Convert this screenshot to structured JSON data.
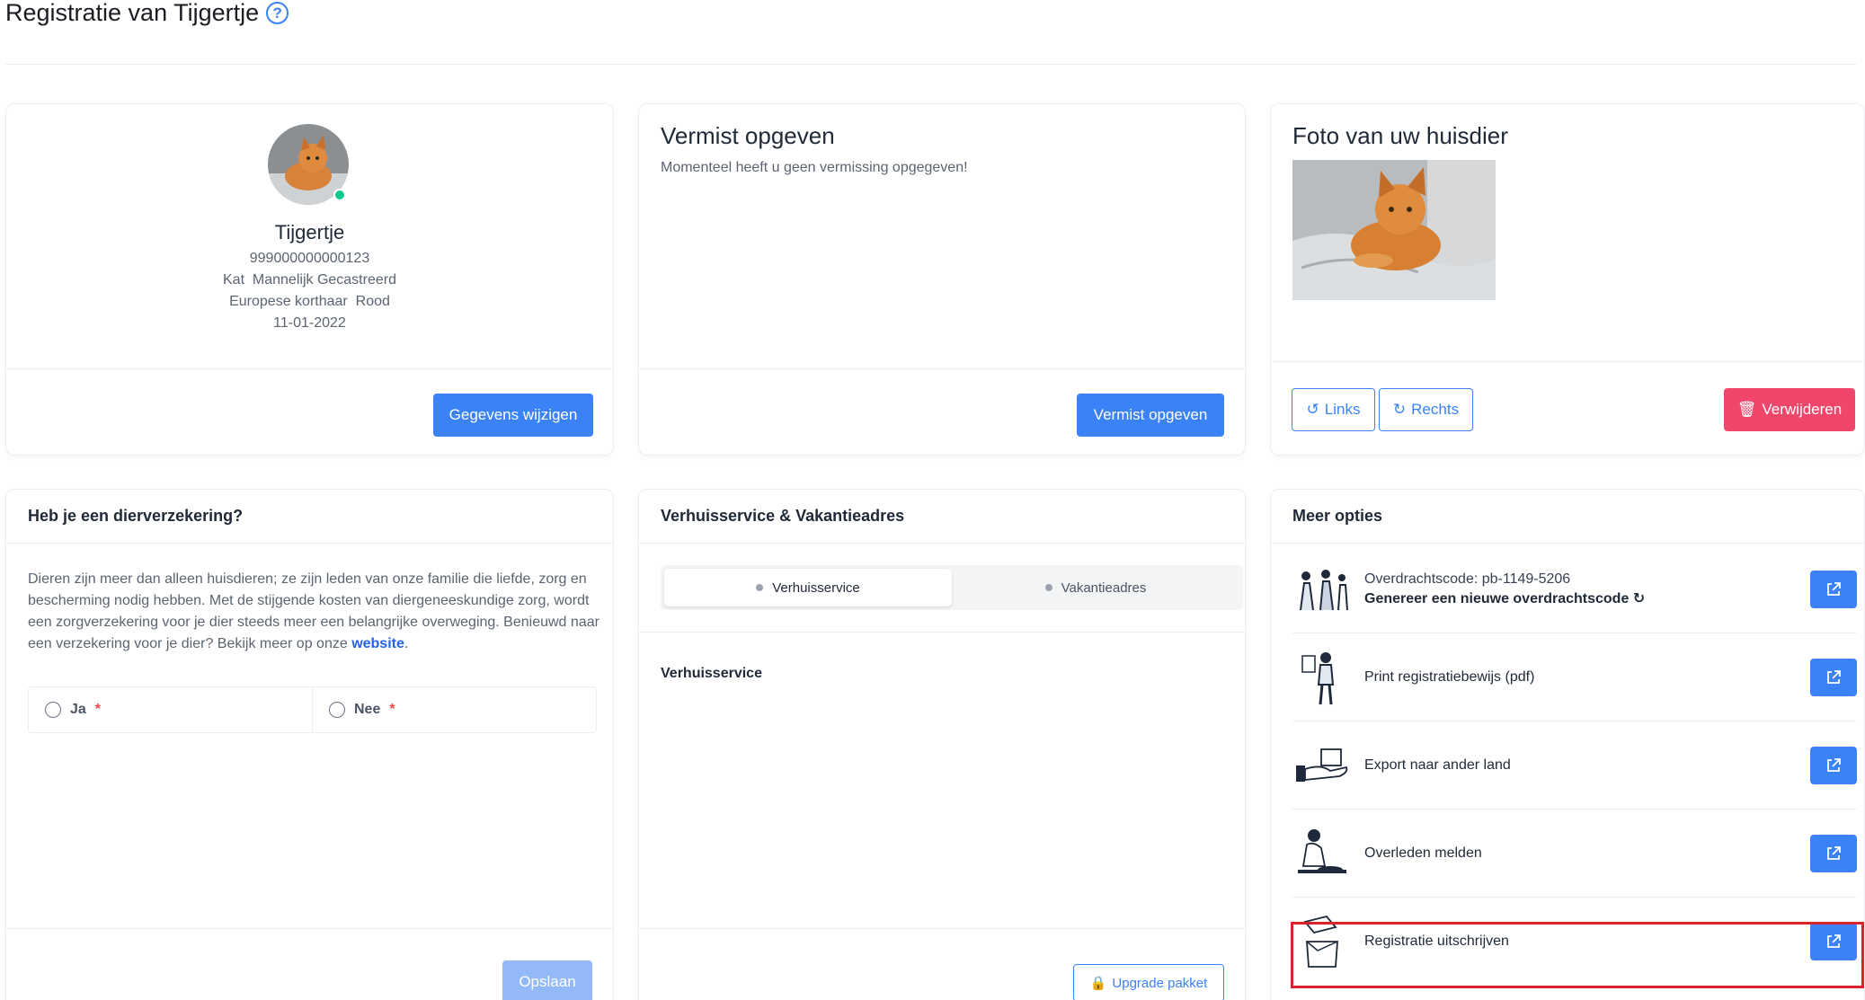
{
  "page": {
    "title": "Registratie van Tijgertje",
    "help_icon": "question-circle-icon"
  },
  "pet": {
    "name": "Tijgertje",
    "chip": "999000000000123",
    "details1": "Kat  Mannelijk Gecastreerd",
    "details2": "Europese korthaar  Rood",
    "dob": "11-01-2022",
    "edit_label": "Gegevens wijzigen"
  },
  "missing": {
    "title": "Vermist opgeven",
    "status": "Momenteel heeft u geen vermissing opgegeven!",
    "button": "Vermist opgeven"
  },
  "photo": {
    "title": "Foto van uw huisdier",
    "rotate_left": "Links",
    "rotate_right": "Rechts",
    "delete": "Verwijderen"
  },
  "insurance": {
    "title": "Heb je een dierverzekering?",
    "text": "Dieren zijn meer dan alleen huisdieren; ze zijn leden van onze familie die liefde, zorg en bescherming nodig hebben. Met de stijgende kosten van diergeneeskundige zorg, wordt een zorgverzekering voor je dier steeds meer een belangrijke overweging. Benieuwd naar een verzekering voor je dier? Bekijk meer op onze ",
    "link": "website",
    "after_link": ".",
    "yes": "Ja",
    "no": "Nee",
    "required_mark": "*",
    "save": "Opslaan"
  },
  "moving": {
    "title": "Verhuisservice & Vakantieadres",
    "tab1": "Verhuisservice",
    "tab2": "Vakantieadres",
    "section": "Verhuisservice",
    "upgrade": "Upgrade pakket"
  },
  "options": {
    "title": "Meer opties",
    "items": [
      {
        "line1": "Overdrachtscode: pb-1149-5206",
        "line2": "Genereer een nieuwe overdrachtscode"
      },
      {
        "label": "Print registratiebewijs (pdf)"
      },
      {
        "label": "Export naar ander land"
      },
      {
        "label": "Overleden melden"
      },
      {
        "label": "Registratie uitschrijven"
      }
    ]
  },
  "colors": {
    "primary": "#3b82f6",
    "danger": "#f0466b",
    "highlight": "#d9242b",
    "online": "#10c98f"
  }
}
